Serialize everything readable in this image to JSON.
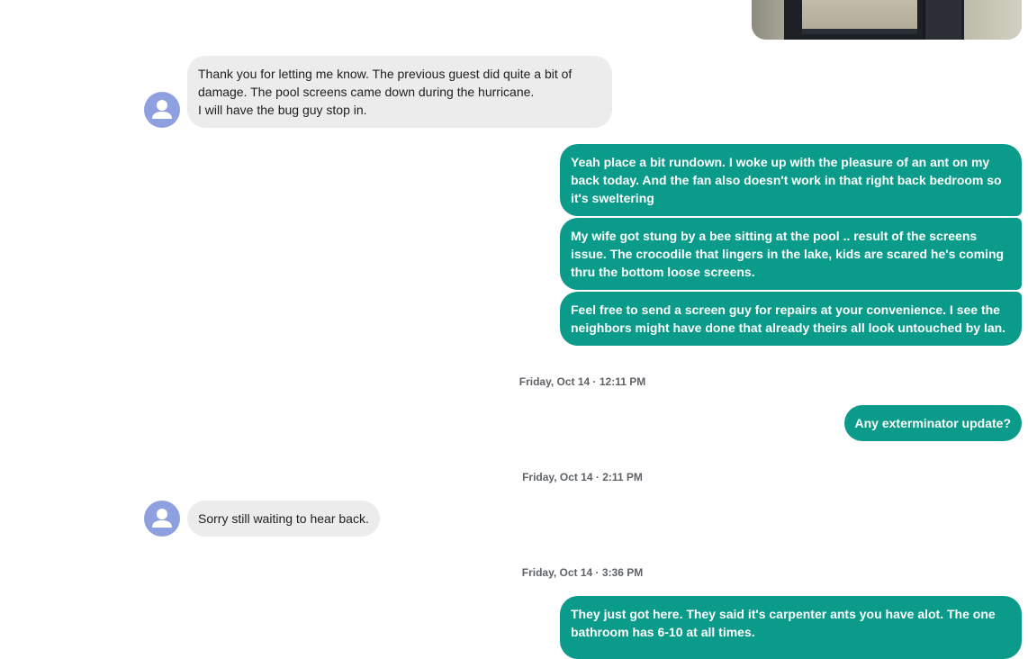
{
  "conversation": {
    "messages": [
      {
        "direction": "incoming",
        "text": "Thank you for letting me know. The previous guest did quite a bit of damage. The pool screens came down during the hurricane.\nI will have the bug guy stop in."
      },
      {
        "direction": "outgoing",
        "text": "Yeah place a bit rundown. I woke up with the pleasure of an ant on my back today. And the fan also doesn't work in that right back bedroom so it's sweltering"
      },
      {
        "direction": "outgoing",
        "text": "My wife got stung by a bee sitting at the pool .. result of the screens issue. The crocodile that lingers in the lake, kids are scared he's coming thru the bottom loose screens."
      },
      {
        "direction": "outgoing",
        "text": "Feel free to send a screen guy for repairs at your convenience. I see the neighbors might have done that already theirs all look untouched by Ian."
      },
      {
        "direction": "outgoing",
        "text": "Any exterminator update?"
      },
      {
        "direction": "incoming",
        "text": "Sorry still waiting to hear back."
      },
      {
        "direction": "outgoing",
        "text": "They just got here. They said it's carpenter ants you have alot. The one bathroom has 6-10 at all times."
      }
    ],
    "timestamps": [
      "Friday, Oct 14 · 12:11 PM",
      "Friday, Oct 14 · 2:11 PM",
      "Friday, Oct 14 · 3:36 PM"
    ]
  },
  "colors": {
    "outgoing_bubble": "#0a9b8a",
    "incoming_bubble": "#ececec",
    "avatar": "#8fa0e0"
  },
  "icons": {
    "avatar": "person-icon",
    "attachment": "photo-thumbnail"
  }
}
